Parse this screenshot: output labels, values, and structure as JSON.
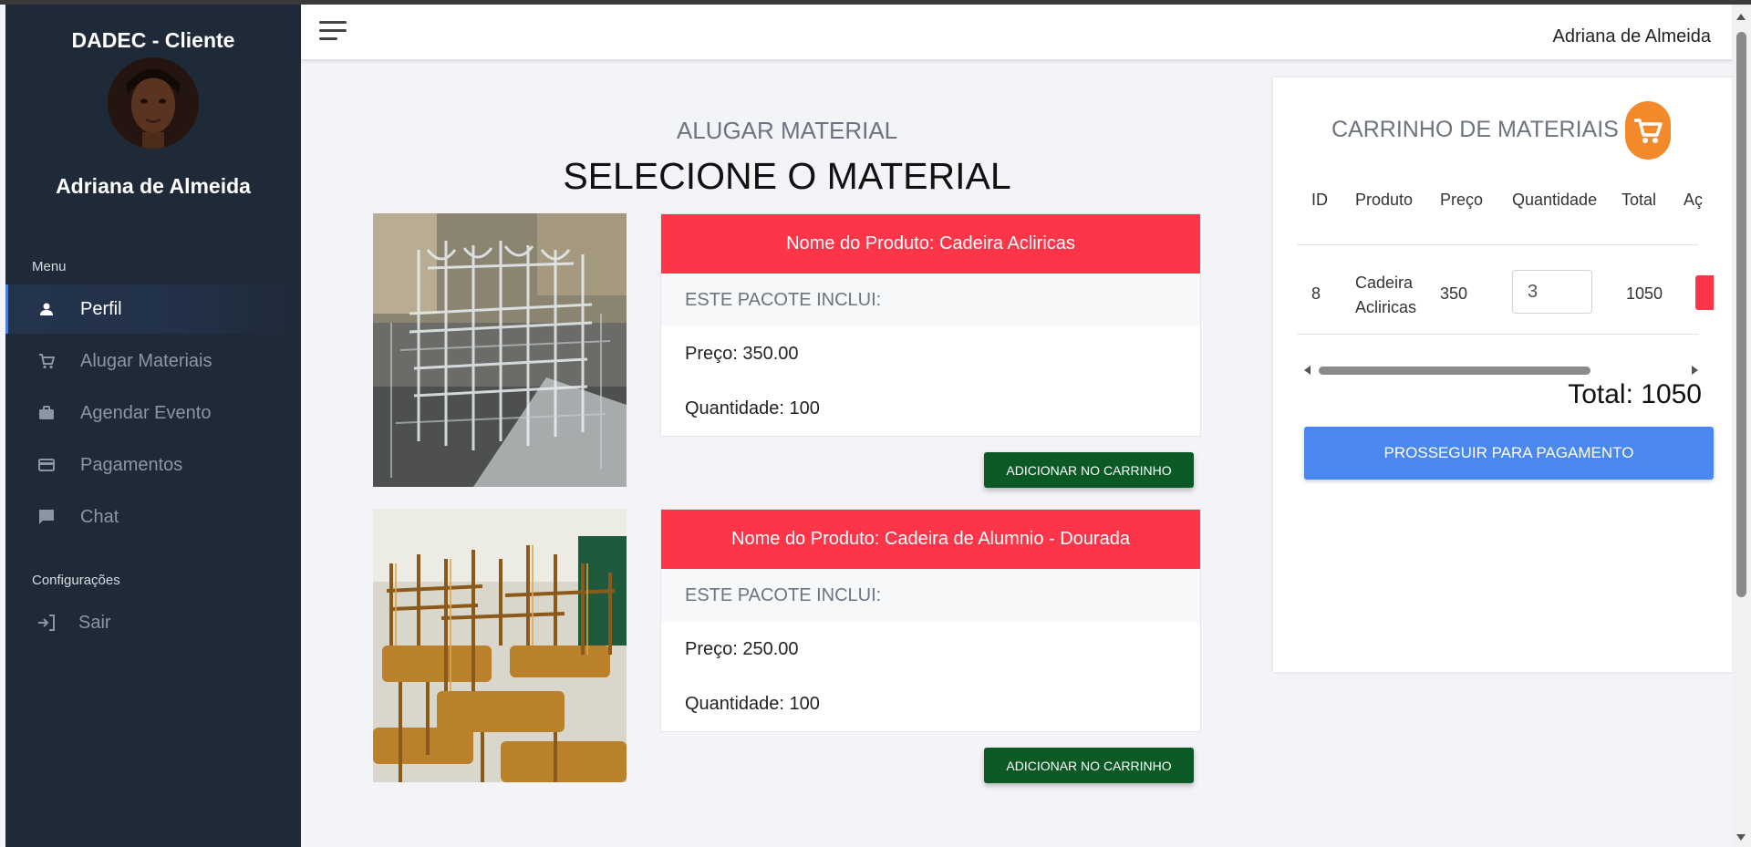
{
  "sidebar": {
    "brand": "DADEC - Cliente",
    "user_name": "Adriana de Almeida",
    "menu_label": "Menu",
    "items": [
      {
        "label": "Perfil",
        "icon": "person-icon"
      },
      {
        "label": "Alugar Materiais",
        "icon": "cart-icon"
      },
      {
        "label": "Agendar Evento",
        "icon": "briefcase-icon"
      },
      {
        "label": "Pagamentos",
        "icon": "credit-card-icon"
      },
      {
        "label": "Chat",
        "icon": "chat-icon"
      }
    ],
    "config_label": "Configurações",
    "logout_label": "Sair"
  },
  "topbar": {
    "user_name": "Adriana de Almeida"
  },
  "main": {
    "subtitle": "ALUGAR MATERIAL",
    "title": "SELECIONE O MATERIAL",
    "products": [
      {
        "name": "Nome do Produto: Cadeira Acliricas",
        "includes": "ESTE PACOTE INCLUI:",
        "price": "Preço: 350.00",
        "quantity": "Quantidade: 100",
        "button": "ADICIONAR NO CARRINHO"
      },
      {
        "name": "Nome do Produto: Cadeira de Alumnio - Dourada",
        "includes": "ESTE PACOTE INCLUI:",
        "price": "Preço: 250.00",
        "quantity": "Quantidade: 100",
        "button": "ADICIONAR NO CARRINHO"
      }
    ]
  },
  "cart": {
    "title": "CARRINHO DE MATERIAIS",
    "columns": [
      "ID",
      "Produto",
      "Preço",
      "Quantidade",
      "Total",
      "Aç"
    ],
    "rows": [
      {
        "id": "8",
        "product_line1": "Cadeira",
        "product_line2": "Acliricas",
        "price": "350",
        "quantity": "3",
        "total": "1050"
      }
    ],
    "total": "Total: 1050",
    "pay_button": "PROSSEGUIR PARA PAGAMENTO"
  },
  "colors": {
    "sidebar_bg": "#1f2a38",
    "product_header": "#fc3549",
    "add_button": "#0b5a26",
    "pay_button": "#4a88f0",
    "cart_icon": "#f28a2c"
  }
}
